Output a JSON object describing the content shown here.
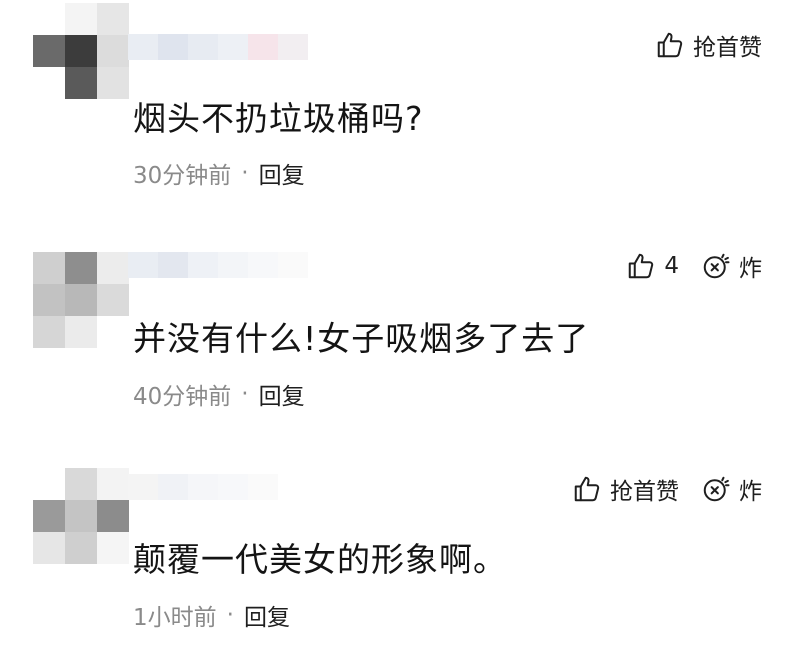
{
  "comments": [
    {
      "text": "烟头不扔垃圾桶吗?",
      "time": "30分钟前",
      "separator": "·",
      "reply_label": "回复",
      "like_label": "抢首赞",
      "bomb_label": ""
    },
    {
      "text": "并没有什么!女子吸烟多了去了",
      "time": "40分钟前",
      "separator": "·",
      "reply_label": "回复",
      "like_label": "4",
      "bomb_label": "炸"
    },
    {
      "text": "颠覆一代美女的形象啊。",
      "time": "1小时前",
      "separator": "·",
      "reply_label": "回复",
      "like_label": "抢首赞",
      "bomb_label": "炸"
    }
  ],
  "icons": {
    "like": "thumbs-up-icon",
    "bomb": "bomb-icon"
  },
  "colors": {
    "text": "#141414",
    "meta": "#8a8a8a",
    "background": "#ffffff"
  }
}
